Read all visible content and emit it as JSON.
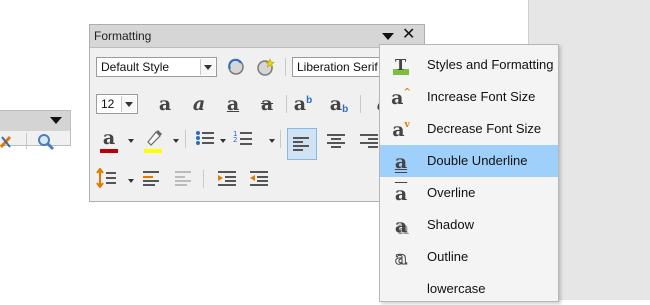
{
  "formatting_toolbar": {
    "title": "Formatting",
    "paragraph_style": "Default Style",
    "font_name": "Liberation Serif",
    "font_size": "12"
  },
  "menu": {
    "items": [
      {
        "label": "Styles and Formatting",
        "icon": "styles-icon",
        "active": false
      },
      {
        "label": "Increase Font Size",
        "icon": "increase-font-icon",
        "active": false
      },
      {
        "label": "Decrease Font Size",
        "icon": "decrease-font-icon",
        "active": false
      },
      {
        "label": "Double Underline",
        "icon": "double-underline-icon",
        "active": true
      },
      {
        "label": "Overline",
        "icon": "overline-icon",
        "active": false
      },
      {
        "label": "Shadow",
        "icon": "shadow-icon",
        "active": false
      },
      {
        "label": "Outline",
        "icon": "outline-icon",
        "active": false
      },
      {
        "label": "lowercase",
        "icon": "lowercase-icon",
        "active": false
      }
    ]
  },
  "colors": {
    "highlight_active": "#9fd0fb",
    "font_color_bar": "#c00000",
    "highlight_color_bar": "#ffff00",
    "accent_orange": "#e27a00"
  }
}
